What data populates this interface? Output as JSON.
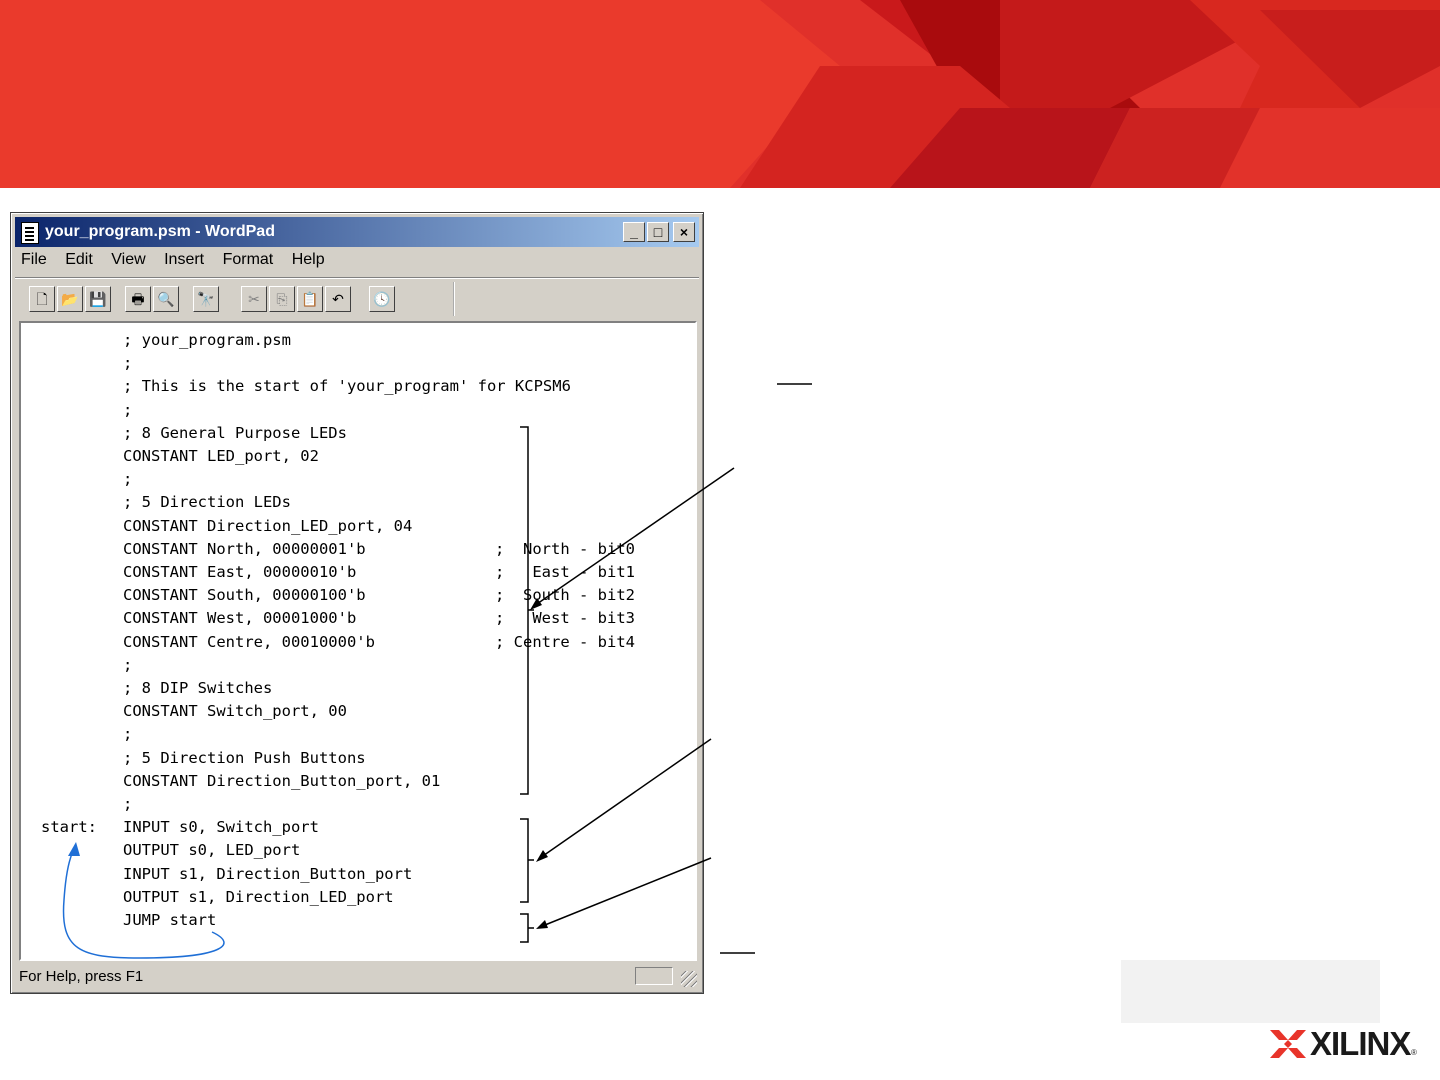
{
  "window": {
    "title": "your_program.psm - WordPad",
    "controls": {
      "minimize": "_",
      "maximize": "□",
      "close": "×"
    }
  },
  "menu": [
    {
      "label": "File"
    },
    {
      "label": "Edit"
    },
    {
      "label": "View"
    },
    {
      "label": "Insert"
    },
    {
      "label": "Format"
    },
    {
      "label": "Help"
    }
  ],
  "toolbar": {
    "buttons": [
      {
        "name": "new-icon",
        "glyph": "🗋"
      },
      {
        "name": "open-icon",
        "glyph": "📂"
      },
      {
        "name": "save-icon",
        "glyph": "💾"
      },
      {
        "name": "print-icon",
        "glyph": "🖶"
      },
      {
        "name": "print-preview-icon",
        "glyph": "🔍"
      },
      {
        "name": "find-icon",
        "glyph": "🔭"
      },
      {
        "name": "cut-icon",
        "glyph": "✂"
      },
      {
        "name": "copy-icon",
        "glyph": "⎘"
      },
      {
        "name": "paste-icon",
        "glyph": "📋"
      },
      {
        "name": "undo-icon",
        "glyph": "↶"
      },
      {
        "name": "date-time-icon",
        "glyph": "🕓"
      }
    ]
  },
  "code": {
    "lines": [
      {
        "label": "",
        "instr": "; your_program.psm",
        "comment": ""
      },
      {
        "label": "",
        "instr": ";",
        "comment": ""
      },
      {
        "label": "",
        "instr": "; This is the start of 'your_program' for KCPSM6",
        "comment": ""
      },
      {
        "label": "",
        "instr": ";",
        "comment": ""
      },
      {
        "label": "",
        "instr": "; 8 General Purpose LEDs",
        "comment": ""
      },
      {
        "label": "",
        "instr": "CONSTANT LED_port, 02",
        "comment": ""
      },
      {
        "label": "",
        "instr": ";",
        "comment": ""
      },
      {
        "label": "",
        "instr": "; 5 Direction LEDs",
        "comment": ""
      },
      {
        "label": "",
        "instr": "CONSTANT Direction_LED_port, 04",
        "comment": ""
      },
      {
        "label": "",
        "instr": "CONSTANT North, 00000001'b",
        "comment": ";  North - bit0"
      },
      {
        "label": "",
        "instr": "CONSTANT East, 00000010'b",
        "comment": ";   East - bit1"
      },
      {
        "label": "",
        "instr": "CONSTANT South, 00000100'b",
        "comment": ";  South - bit2"
      },
      {
        "label": "",
        "instr": "CONSTANT West, 00001000'b",
        "comment": ";   West - bit3"
      },
      {
        "label": "",
        "instr": "CONSTANT Centre, 00010000'b",
        "comment": "; Centre - bit4"
      },
      {
        "label": "",
        "instr": ";",
        "comment": ""
      },
      {
        "label": "",
        "instr": "; 8 DIP Switches",
        "comment": ""
      },
      {
        "label": "",
        "instr": "CONSTANT Switch_port, 00",
        "comment": ""
      },
      {
        "label": "",
        "instr": ";",
        "comment": ""
      },
      {
        "label": "",
        "instr": "; 5 Direction Push Buttons",
        "comment": ""
      },
      {
        "label": "",
        "instr": "CONSTANT Direction_Button_port, 01",
        "comment": ""
      },
      {
        "label": "",
        "instr": ";",
        "comment": ""
      },
      {
        "label": "start:",
        "instr": "INPUT s0, Switch_port",
        "comment": ""
      },
      {
        "label": "",
        "instr": "OUTPUT s0, LED_port",
        "comment": ""
      },
      {
        "label": "",
        "instr": "INPUT s1, Direction_Button_port",
        "comment": ""
      },
      {
        "label": "",
        "instr": "OUTPUT s1, Direction_LED_port",
        "comment": ""
      },
      {
        "label": "",
        "instr": "JUMP start",
        "comment": ""
      }
    ]
  },
  "status": {
    "text": "For Help, press F1"
  },
  "colors": {
    "banner_red": "#e8342a",
    "banner_dark": "#a50b0b",
    "titlebar": "#0a246a",
    "loop_arrow": "#1f6fd6"
  },
  "logo": {
    "text": "XILINX",
    "reg": "®"
  }
}
